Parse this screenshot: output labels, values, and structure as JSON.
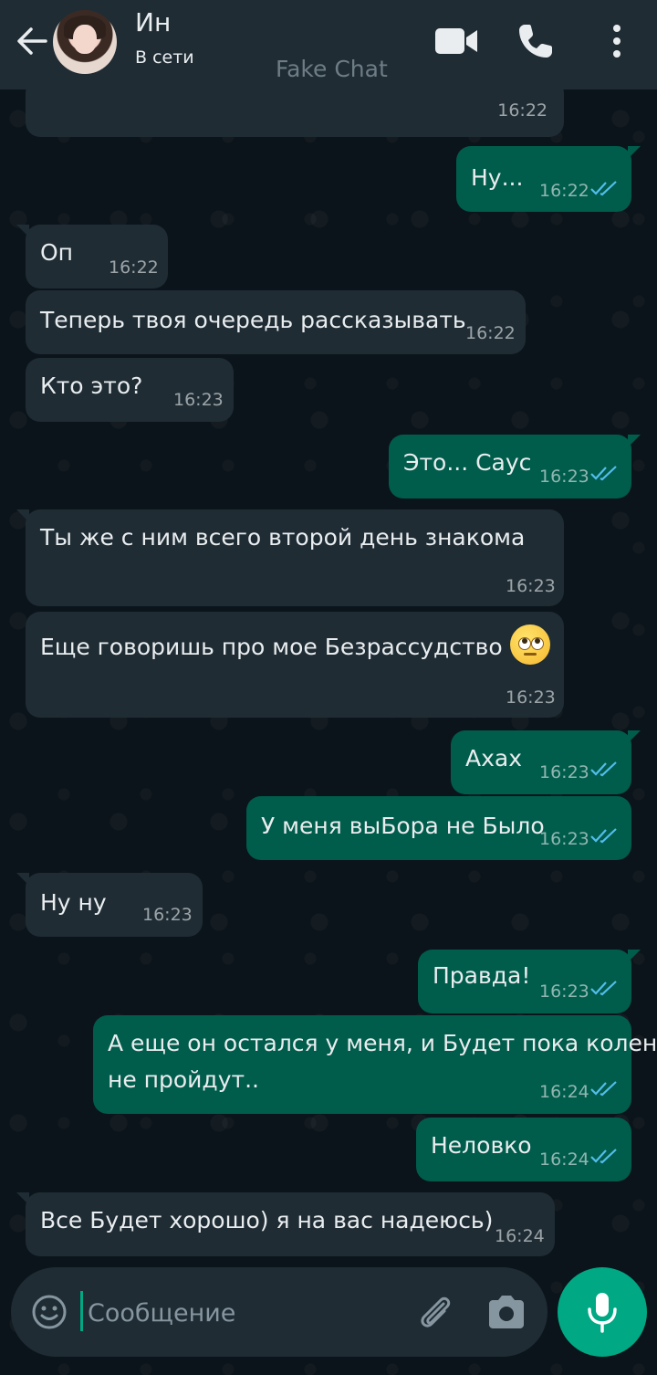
{
  "header": {
    "contact_name": "Ин",
    "contact_status": "В сети",
    "watermark": "Fake Chat"
  },
  "messages": [
    {
      "dir": "in",
      "text": "",
      "time": "16:22"
    },
    {
      "dir": "out",
      "text": "Ну...",
      "time": "16:22",
      "read": true
    },
    {
      "dir": "in",
      "text": "Оп",
      "time": "16:22"
    },
    {
      "dir": "in",
      "text": "Теперь твоя очередь рассказывать",
      "time": "16:22"
    },
    {
      "dir": "in",
      "text": "Кто это?",
      "time": "16:23"
    },
    {
      "dir": "out",
      "text": "Это... Саус",
      "time": "16:23",
      "read": true
    },
    {
      "dir": "in",
      "text": "Ты же с ним всего второй день знакома",
      "time": "16:23"
    },
    {
      "dir": "in",
      "text": "Еще говоришь про мое Безрассудство",
      "emoji": "face-with-rolling-eyes",
      "time": "16:23"
    },
    {
      "dir": "out",
      "text": "Ахах",
      "time": "16:23",
      "read": true
    },
    {
      "dir": "out",
      "text": "У меня выБора не Было",
      "time": "16:23",
      "read": true
    },
    {
      "dir": "in",
      "text": "Ну ну",
      "time": "16:23"
    },
    {
      "dir": "out",
      "text": "Правда!",
      "time": "16:23",
      "read": true
    },
    {
      "dir": "out",
      "text_line1": "А еще он остался у меня, и Будет пока колени",
      "text_line2": "не пройдут..",
      "time": "16:24",
      "read": true
    },
    {
      "dir": "out",
      "text": "Неловко",
      "time": "16:24",
      "read": true
    },
    {
      "dir": "in",
      "text": "Все Будет хорошо) я на вас надеюсь)",
      "time": "16:24"
    }
  ],
  "input": {
    "placeholder": "Сообщение"
  },
  "colors": {
    "header_bg": "#1f2c34",
    "chat_bg": "#0b141a",
    "incoming_bubble": "#1f2c34",
    "outgoing_bubble": "#005c4b",
    "read_ticks": "#53bdeb",
    "accent": "#00a884"
  },
  "icons": [
    "back-arrow-icon",
    "video-call-icon",
    "phone-call-icon",
    "more-vert-icon",
    "emoji-icon",
    "attach-icon",
    "camera-icon",
    "mic-icon",
    "double-check-icon"
  ]
}
